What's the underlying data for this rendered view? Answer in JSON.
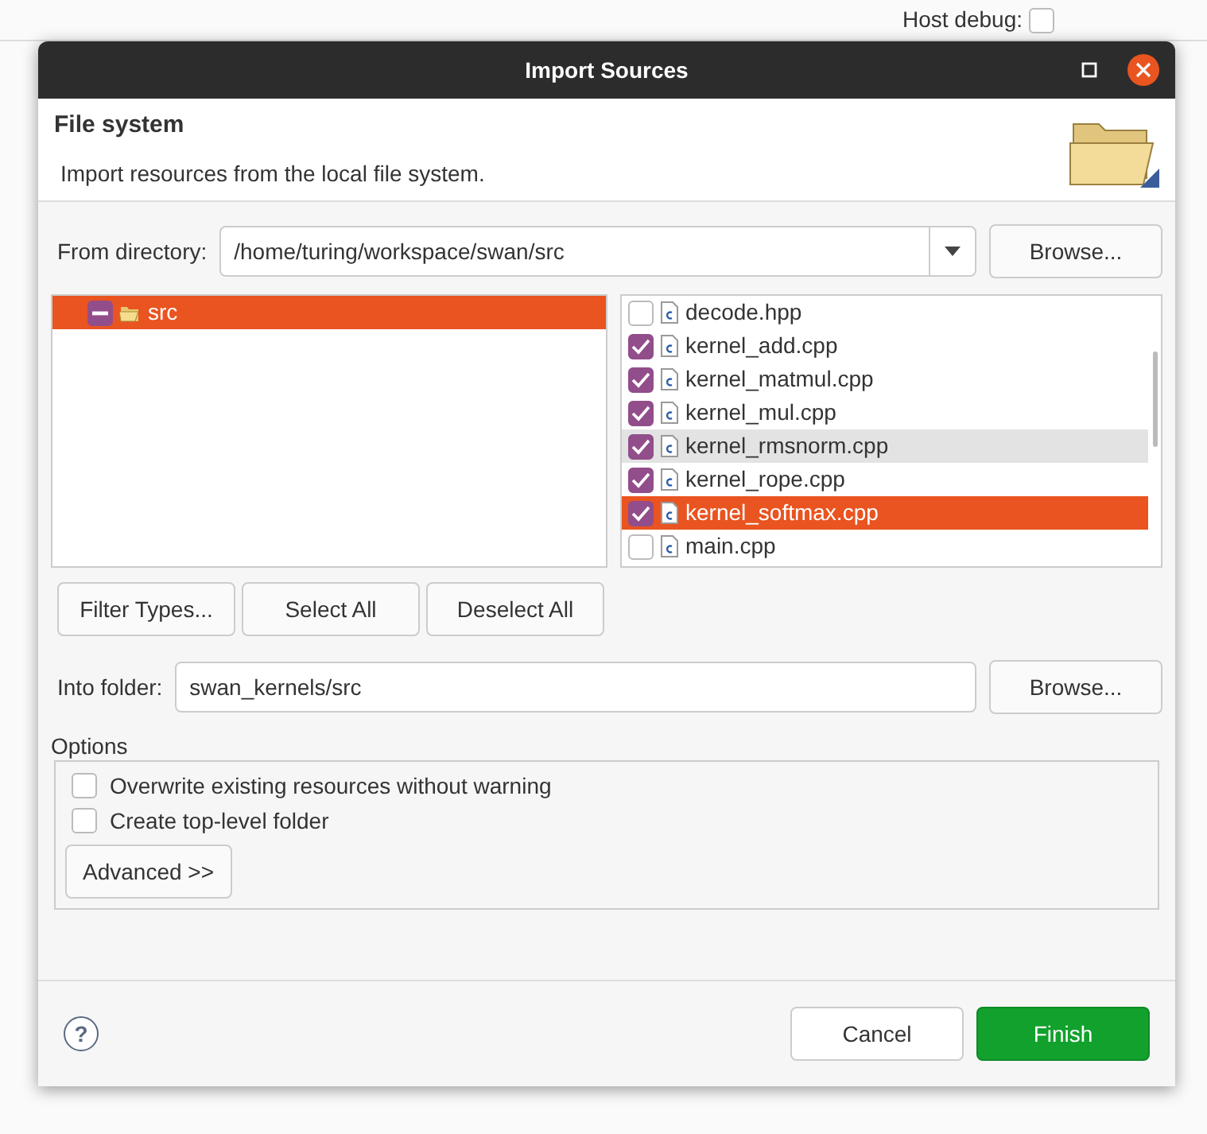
{
  "background": {
    "host_debug": {
      "label": "Host debug:",
      "checked": false
    }
  },
  "window": {
    "title": "Import Sources"
  },
  "header": {
    "title": "File system",
    "description": "Import resources from the local file system."
  },
  "from_directory": {
    "label": "From directory:",
    "value": "/home/turing/workspace/swan/src",
    "button": "Browse..."
  },
  "folders": [
    {
      "label": "src",
      "checked": true,
      "partial": true,
      "selected": true
    }
  ],
  "files": [
    {
      "name": "decode.hpp",
      "checked": false,
      "selected": false,
      "highlighted": false
    },
    {
      "name": "kernel_add.cpp",
      "checked": true,
      "selected": false,
      "highlighted": false
    },
    {
      "name": "kernel_matmul.cpp",
      "checked": true,
      "selected": false,
      "highlighted": false
    },
    {
      "name": "kernel_mul.cpp",
      "checked": true,
      "selected": false,
      "highlighted": false
    },
    {
      "name": "kernel_rmsnorm.cpp",
      "checked": true,
      "selected": false,
      "highlighted": true
    },
    {
      "name": "kernel_rope.cpp",
      "checked": true,
      "selected": false,
      "highlighted": false
    },
    {
      "name": "kernel_softmax.cpp",
      "checked": true,
      "selected": true,
      "highlighted": false
    },
    {
      "name": "main.cpp",
      "checked": false,
      "selected": false,
      "highlighted": false
    }
  ],
  "selection_buttons": [
    "Filter Types...",
    "Select All",
    "Deselect All"
  ],
  "into_folder": {
    "label": "Into folder:",
    "value": "swan_kernels/src",
    "button": "Browse..."
  },
  "options": {
    "title": "Options",
    "checkboxes": [
      {
        "label": "Overwrite existing resources without warning",
        "checked": false
      },
      {
        "label": "Create top-level folder",
        "checked": false
      }
    ],
    "advanced": "Advanced >>"
  },
  "footer": {
    "help": "?",
    "cancel": "Cancel",
    "finish": "Finish"
  }
}
